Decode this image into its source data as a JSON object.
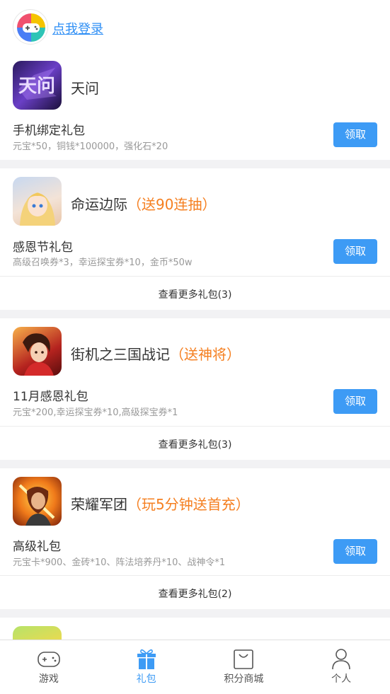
{
  "header": {
    "login_text": "点我登录"
  },
  "games": [
    {
      "name": "天问",
      "promo": "",
      "gift_name": "手机绑定礼包",
      "gift_desc": "元宝*50，铜钱*100000，强化石*20",
      "claim_label": "领取",
      "more_text": ""
    },
    {
      "name": "命运边际",
      "promo": "（送90连抽）",
      "gift_name": "感恩节礼包",
      "gift_desc": "高级召唤券*3，幸运探宝券*10，金币*50w",
      "claim_label": "领取",
      "more_text": "查看更多礼包(3)"
    },
    {
      "name": "街机之三国战记",
      "promo": "（送神将）",
      "gift_name": "11月感恩礼包",
      "gift_desc": "元宝*200,幸运探宝券*10,高级探宝券*1",
      "claim_label": "领取",
      "more_text": "查看更多礼包(3)"
    },
    {
      "name": "荣耀军团",
      "promo": "（玩5分钟送首充）",
      "gift_name": "高级礼包",
      "gift_desc": "元宝卡*900、金砖*10、阵法培养丹*10、战神令*1",
      "claim_label": "领取",
      "more_text": "查看更多礼包(2)"
    }
  ],
  "tabs": [
    {
      "label": "游戏",
      "icon": "gamepad-icon"
    },
    {
      "label": "礼包",
      "icon": "gift-icon",
      "active": true
    },
    {
      "label": "积分商城",
      "icon": "shopping-bag-icon"
    },
    {
      "label": "个人",
      "icon": "person-icon"
    }
  ],
  "colors": {
    "accent": "#3d9bf5",
    "promo": "#f57f20",
    "link": "#2f8ff5"
  }
}
